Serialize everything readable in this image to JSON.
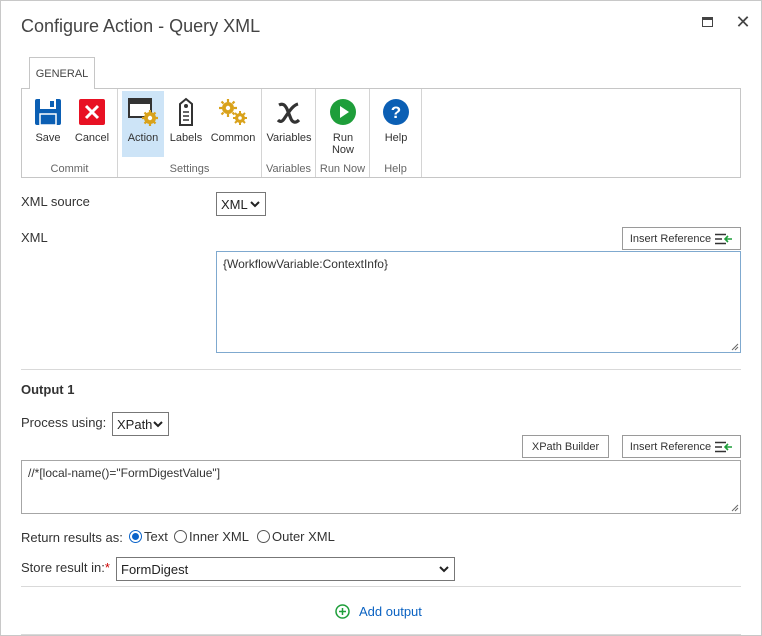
{
  "window": {
    "title": "Configure Action - Query XML",
    "maximize_icon": "maximize-icon",
    "close_glyph": "✕"
  },
  "ribbon": {
    "tab_label": "GENERAL",
    "groups": {
      "commit": {
        "label": "Commit",
        "save": {
          "label": "Save",
          "icon": "save-icon"
        },
        "cancel": {
          "label": "Cancel",
          "icon": "cancel-icon"
        }
      },
      "settings": {
        "label": "Settings",
        "action": {
          "label": "Action",
          "icon": "action-icon",
          "active": true
        },
        "labels": {
          "label": "Labels",
          "icon": "labels-tag-icon"
        },
        "common": {
          "label": "Common",
          "icon": "common-gears-icon"
        }
      },
      "variables": {
        "label": "Variables",
        "variables": {
          "label": "Variables",
          "icon": "variable-x-icon"
        }
      },
      "runnow": {
        "label": "Run Now",
        "run_line1": "Run",
        "run_line2": "Now",
        "icon": "play-icon"
      },
      "help": {
        "label": "Help",
        "help": {
          "label": "Help",
          "icon": "help-question-icon"
        }
      }
    }
  },
  "form": {
    "xml_source": {
      "label": "XML source",
      "value": "XML"
    },
    "xml": {
      "label": "XML",
      "insert_reference": "Insert Reference",
      "value": "{WorkflowVariable:ContextInfo}"
    },
    "output": {
      "title": "Output 1",
      "process_label": "Process using:",
      "process_value": "XPath",
      "xpath_builder": "XPath Builder",
      "insert_reference": "Insert Reference",
      "xpath_value": "//*[local-name()=\"FormDigestValue\"]",
      "return_label": "Return results as:",
      "return_options": [
        "Text",
        "Inner XML",
        "Outer XML"
      ],
      "return_selected": "Text",
      "store_label": "Store result in:",
      "store_required_mark": "*",
      "store_value": "FormDigest"
    },
    "add_output": "Add output"
  },
  "colors": {
    "accent": "#0a63c9",
    "save_blue": "#0b5fb4",
    "cancel_red": "#e81123",
    "gear_gold": "#d9a21b",
    "run_green": "#1e9e3a",
    "active_bg": "#cde4f7"
  }
}
